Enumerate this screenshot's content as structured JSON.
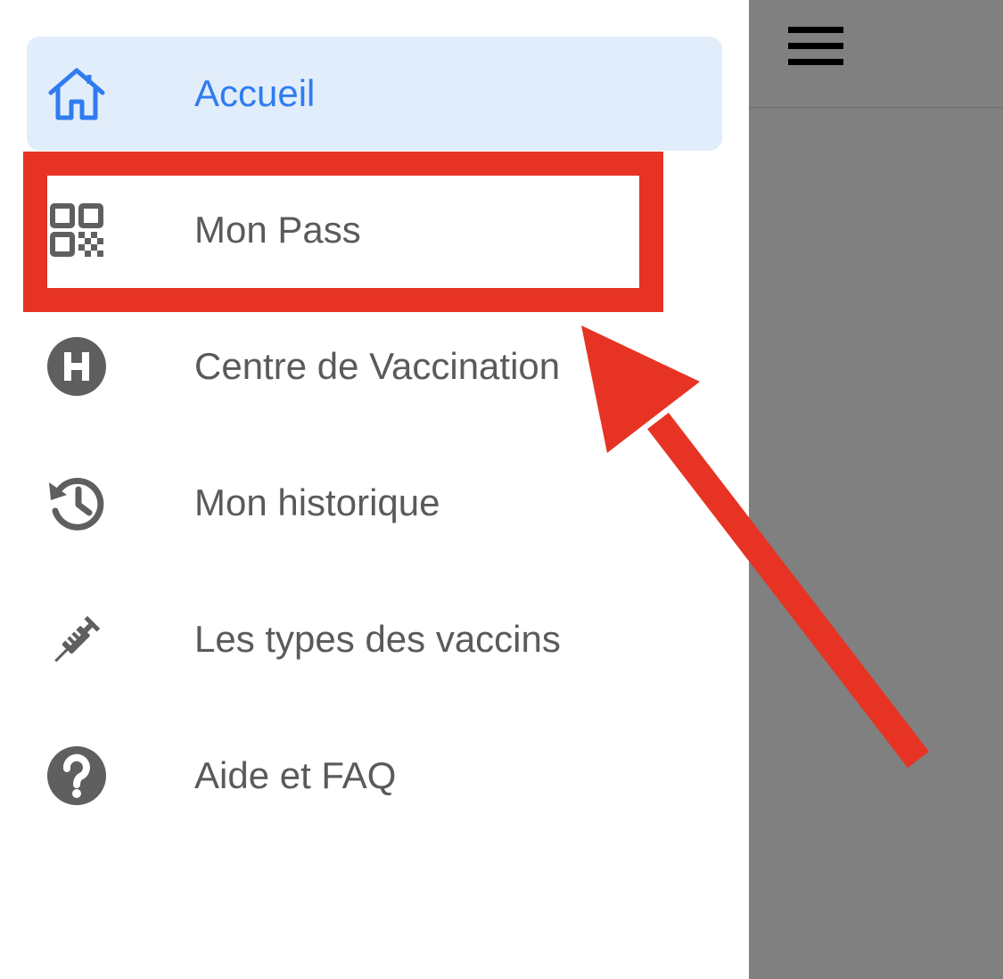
{
  "menu": {
    "items": [
      {
        "label": "Accueil",
        "icon": "home-icon",
        "active": true
      },
      {
        "label": "Mon Pass",
        "icon": "qr-code-icon",
        "active": false
      },
      {
        "label": "Centre de Vaccination",
        "icon": "hospital-icon",
        "active": false
      },
      {
        "label": "Mon historique",
        "icon": "history-icon",
        "active": false
      },
      {
        "label": "Les types des vaccins",
        "icon": "syringe-icon",
        "active": false
      },
      {
        "label": "Aide et FAQ",
        "icon": "help-icon",
        "active": false
      }
    ]
  },
  "header": {
    "menu_icon": "hamburger-menu-icon"
  },
  "annotation": {
    "highlighted_item": "Mon Pass",
    "color": "#e73324"
  },
  "colors": {
    "active_text": "#2f7cf0",
    "active_bg": "#e2edfb",
    "text": "#5a5a5a",
    "icon": "#5f5f5f",
    "overlay": "#808080"
  }
}
